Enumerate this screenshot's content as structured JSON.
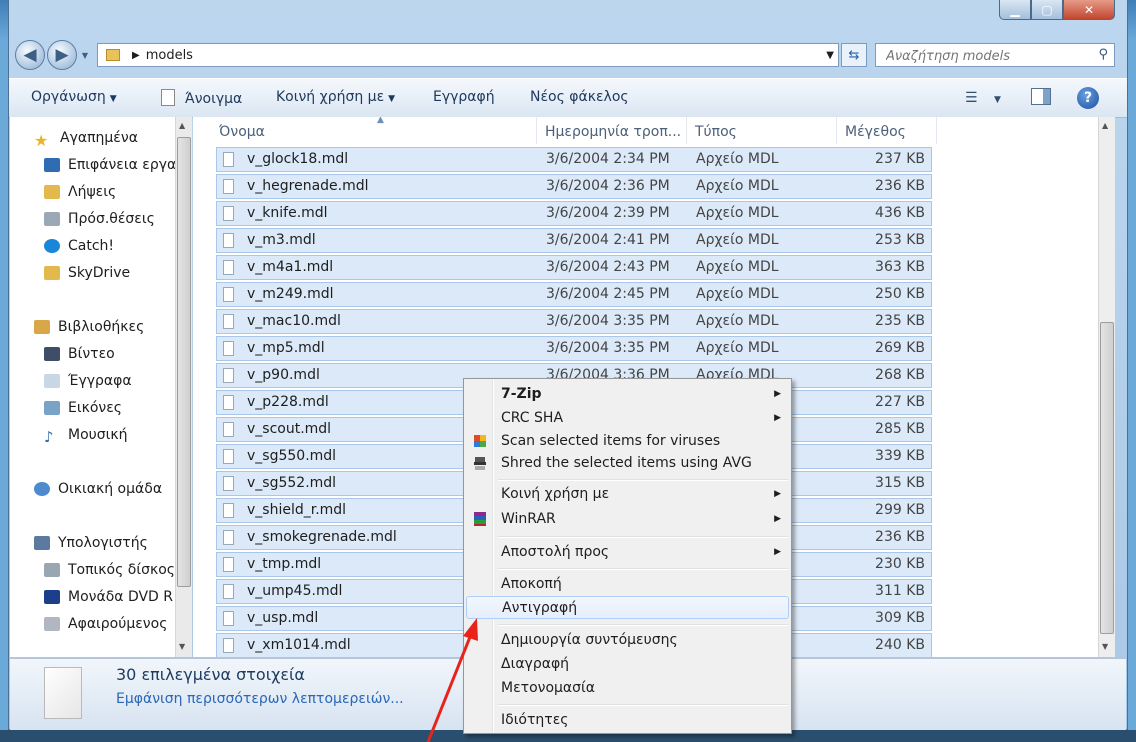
{
  "window": {
    "controls": {
      "minimize": "▁",
      "maximize": "▢",
      "close": "✕"
    }
  },
  "address": {
    "path": "models",
    "search_placeholder": "Αναζήτηση models"
  },
  "toolbar": {
    "organize": "Οργάνωση",
    "open": "Άνοιγμα",
    "share": "Κοινή χρήση με",
    "burn": "Εγγραφή",
    "new_folder": "Νέος φάκελος",
    "help": "?"
  },
  "nav": {
    "favorites": "Αγαπημένα",
    "desktop": "Επιφάνεια εργα",
    "downloads": "Λήψεις",
    "recent": "Πρόσ.θέσεις",
    "catch": "Catch!",
    "skydrive": "SkyDrive",
    "libraries": "Βιβλιοθήκες",
    "videos": "Βίντεο",
    "documents": "Έγγραφα",
    "pictures": "Εικόνες",
    "music": "Μουσική",
    "homegroup": "Οικιακή ομάδα",
    "computer": "Υπολογιστής",
    "local_disk": "Τοπικός δίσκος",
    "dvd": "Μονάδα DVD R",
    "removable": "Αφαιρούμενος"
  },
  "columns": {
    "name": "Όνομα",
    "date": "Ημερομηνία τροπ...",
    "type": "Τύπος",
    "size": "Μέγεθος"
  },
  "files": [
    {
      "name": "v_glock18.mdl",
      "date": "3/6/2004 2:34 PM",
      "type": "Αρχείο MDL",
      "size": "237 KB"
    },
    {
      "name": "v_hegrenade.mdl",
      "date": "3/6/2004 2:36 PM",
      "type": "Αρχείο MDL",
      "size": "236 KB"
    },
    {
      "name": "v_knife.mdl",
      "date": "3/6/2004 2:39 PM",
      "type": "Αρχείο MDL",
      "size": "436 KB"
    },
    {
      "name": "v_m3.mdl",
      "date": "3/6/2004 2:41 PM",
      "type": "Αρχείο MDL",
      "size": "253 KB"
    },
    {
      "name": "v_m4a1.mdl",
      "date": "3/6/2004 2:43 PM",
      "type": "Αρχείο MDL",
      "size": "363 KB"
    },
    {
      "name": "v_m249.mdl",
      "date": "3/6/2004 2:45 PM",
      "type": "Αρχείο MDL",
      "size": "250 KB"
    },
    {
      "name": "v_mac10.mdl",
      "date": "3/6/2004 3:35 PM",
      "type": "Αρχείο MDL",
      "size": "235 KB"
    },
    {
      "name": "v_mp5.mdl",
      "date": "3/6/2004 3:35 PM",
      "type": "Αρχείο MDL",
      "size": "269 KB"
    },
    {
      "name": "v_p90.mdl",
      "date": "3/6/2004 3:36 PM",
      "type": "Αρχείο MDL",
      "size": "268 KB"
    },
    {
      "name": "v_p228.mdl",
      "date": "",
      "type": "",
      "size": "227 KB"
    },
    {
      "name": "v_scout.mdl",
      "date": "",
      "type": "",
      "size": "285 KB"
    },
    {
      "name": "v_sg550.mdl",
      "date": "",
      "type": "",
      "size": "339 KB"
    },
    {
      "name": "v_sg552.mdl",
      "date": "",
      "type": "",
      "size": "315 KB"
    },
    {
      "name": "v_shield_r.mdl",
      "date": "",
      "type": "",
      "size": "299 KB"
    },
    {
      "name": "v_smokegrenade.mdl",
      "date": "",
      "type": "",
      "size": "236 KB"
    },
    {
      "name": "v_tmp.mdl",
      "date": "",
      "type": "",
      "size": "230 KB"
    },
    {
      "name": "v_ump45.mdl",
      "date": "",
      "type": "",
      "size": "311 KB"
    },
    {
      "name": "v_usp.mdl",
      "date": "",
      "type": "",
      "size": "309 KB"
    },
    {
      "name": "v_xm1014.mdl",
      "date": "",
      "type": "",
      "size": "240 KB"
    }
  ],
  "details": {
    "count": "30 επιλεγμένα στοιχεία",
    "more": "Εμφάνιση περισσότερων λεπτομερειών..."
  },
  "context_menu": {
    "items": [
      "7-Zip",
      "CRC SHA",
      "Scan selected items for viruses",
      "Shred the selected items using AVG",
      "Κοινή χρήση με",
      "WinRAR",
      "Αποστολή προς",
      "Αποκοπή",
      "Αντιγραφή",
      "Δημιουργία συντόμευσης",
      "Διαγραφή",
      "Μετονομασία",
      "Ιδιότητες"
    ]
  },
  "colors": {
    "selection": "#dbe9f8",
    "selection_border": "#a9c7ea",
    "annotation_arrow": "#e8231a"
  }
}
